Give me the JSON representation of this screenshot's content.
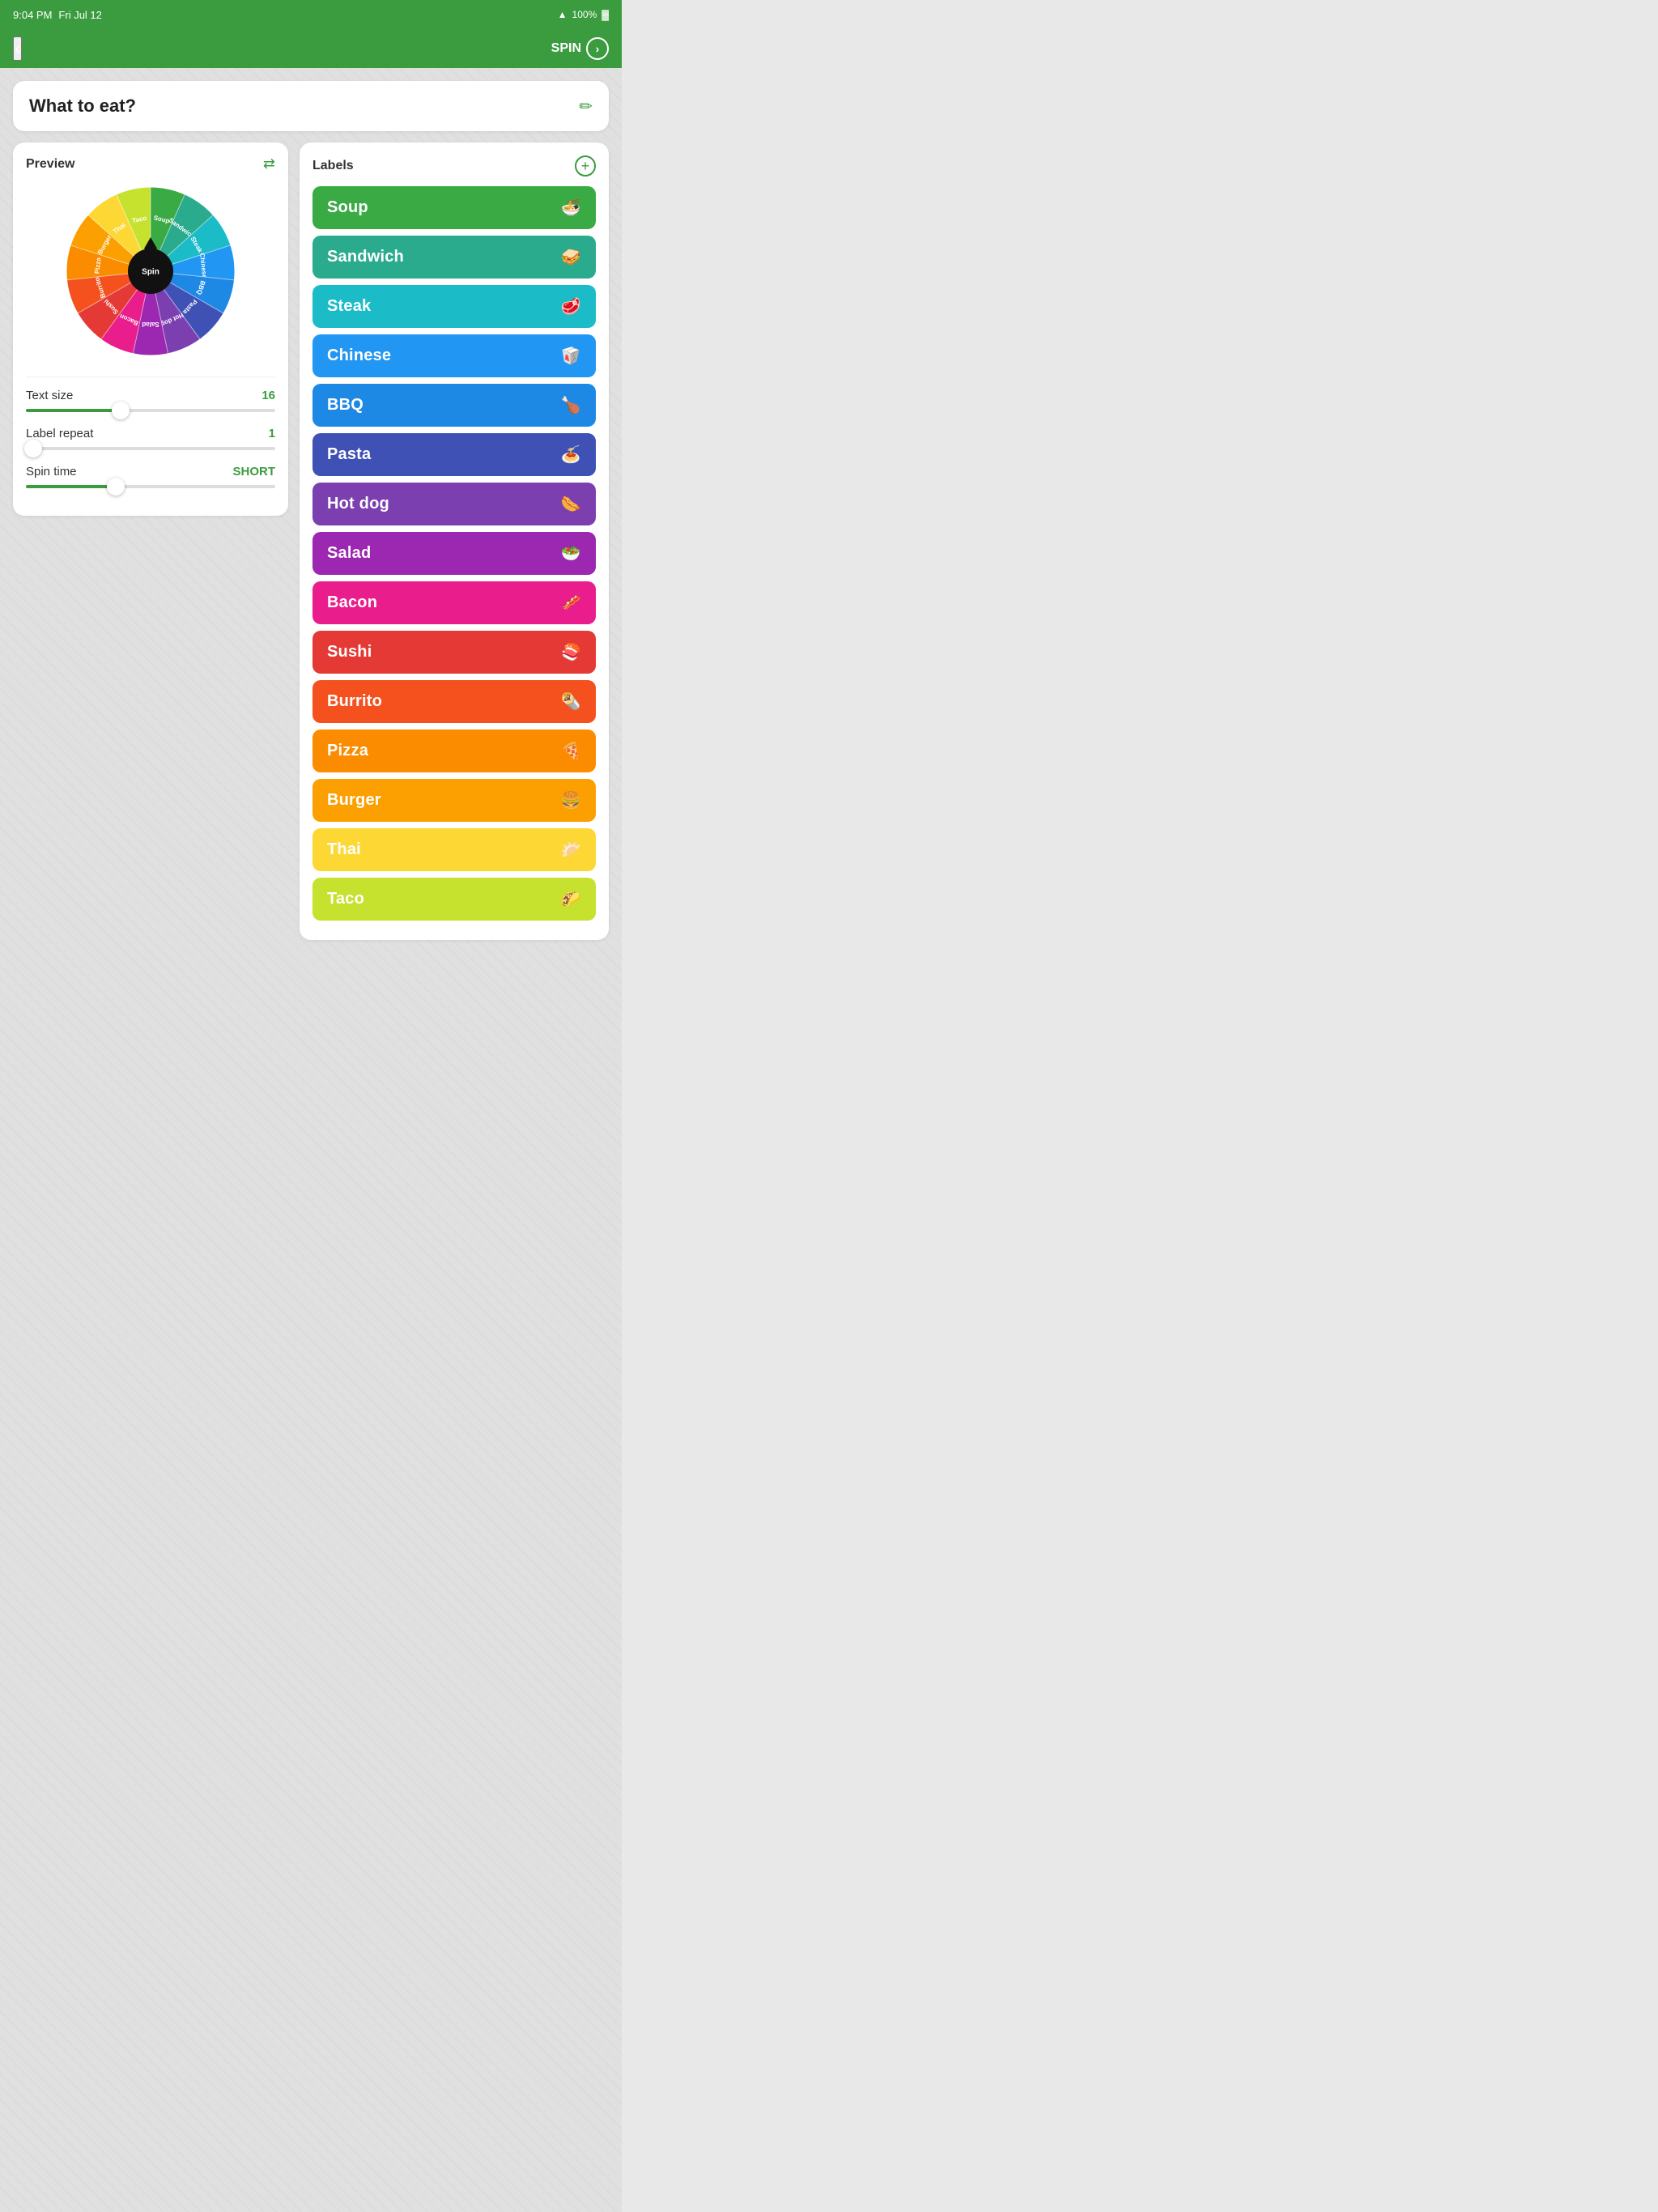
{
  "statusBar": {
    "time": "9:04 PM",
    "date": "Fri Jul 12",
    "battery": "100%",
    "batteryIcon": "🔋",
    "wifiIcon": "wifi"
  },
  "navBar": {
    "backLabel": "‹",
    "spinLabel": "SPIN"
  },
  "titleCard": {
    "title": "What to eat?",
    "editIcon": "✏"
  },
  "leftPanel": {
    "previewLabel": "Preview",
    "shuffleIcon": "⇄",
    "spinLabel": "Spin",
    "textSizeLabel": "Text size",
    "textSizeValue": "16",
    "textSizeFillPercent": 38,
    "textSizeThumbPercent": 38,
    "labelRepeatLabel": "Label repeat",
    "labelRepeatValue": "1",
    "labelRepeatFillPercent": 3,
    "labelRepeatThumbPercent": 3,
    "spinTimeLabel": "Spin time",
    "spinTimeValue": "SHORT",
    "spinTimeFillPercent": 36,
    "spinTimeThumbPercent": 36
  },
  "rightPanel": {
    "labelsTitle": "Labels",
    "addIcon": "+",
    "labels": [
      {
        "name": "Soup",
        "emoji": "🍜",
        "color": "#3aaa45"
      },
      {
        "name": "Sandwich",
        "emoji": "🥪",
        "color": "#2aab8e"
      },
      {
        "name": "Steak",
        "emoji": "🥩",
        "color": "#1bbcc8"
      },
      {
        "name": "Chinese",
        "emoji": "🥡",
        "color": "#2196f3"
      },
      {
        "name": "BBQ",
        "emoji": "🍗",
        "color": "#1e88e5"
      },
      {
        "name": "Pasta",
        "emoji": "🍝",
        "color": "#3f51b5"
      },
      {
        "name": "Hot dog",
        "emoji": "🌭",
        "color": "#7b3fb0"
      },
      {
        "name": "Salad",
        "emoji": "🥗",
        "color": "#9c27b0"
      },
      {
        "name": "Bacon",
        "emoji": "🥓",
        "color": "#e91e8c"
      },
      {
        "name": "Sushi",
        "emoji": "🍣",
        "color": "#e53935"
      },
      {
        "name": "Burrito",
        "emoji": "🌯",
        "color": "#f4511e"
      },
      {
        "name": "Pizza",
        "emoji": "🍕",
        "color": "#fb8c00"
      },
      {
        "name": "Burger",
        "emoji": "🍔",
        "color": "#fba000"
      },
      {
        "name": "Thai",
        "emoji": "🥟",
        "color": "#fdd835"
      },
      {
        "name": "Taco",
        "emoji": "🌮",
        "color": "#c6e22e"
      }
    ]
  },
  "wheel": {
    "segments": [
      {
        "label": "Soup",
        "color": "#3aaa45",
        "textColor": "#fff"
      },
      {
        "label": "Sandwich",
        "color": "#2aab8e",
        "textColor": "#fff"
      },
      {
        "label": "Steak",
        "color": "#1bbcc8",
        "textColor": "#fff"
      },
      {
        "label": "Chinese",
        "color": "#2196f3",
        "textColor": "#fff"
      },
      {
        "label": "BBQ",
        "color": "#1e88e5",
        "textColor": "#fff"
      },
      {
        "label": "Pasta",
        "color": "#3f51b5",
        "textColor": "#fff"
      },
      {
        "label": "Hot dog",
        "color": "#7b3fb0",
        "textColor": "#fff"
      },
      {
        "label": "Salad",
        "color": "#9c27b0",
        "textColor": "#fff"
      },
      {
        "label": "Bacon",
        "color": "#e91e8c",
        "textColor": "#fff"
      },
      {
        "label": "Sushi",
        "color": "#e53935",
        "textColor": "#fff"
      },
      {
        "label": "Burrito",
        "color": "#f4511e",
        "textColor": "#fff"
      },
      {
        "label": "Pizza",
        "color": "#fb8c00",
        "textColor": "#fff"
      },
      {
        "label": "Burger",
        "color": "#fba000",
        "textColor": "#fff"
      },
      {
        "label": "Thai",
        "color": "#fdd835",
        "textColor": "#fff"
      },
      {
        "label": "Taco",
        "color": "#c6e22e",
        "textColor": "#fff"
      }
    ]
  }
}
